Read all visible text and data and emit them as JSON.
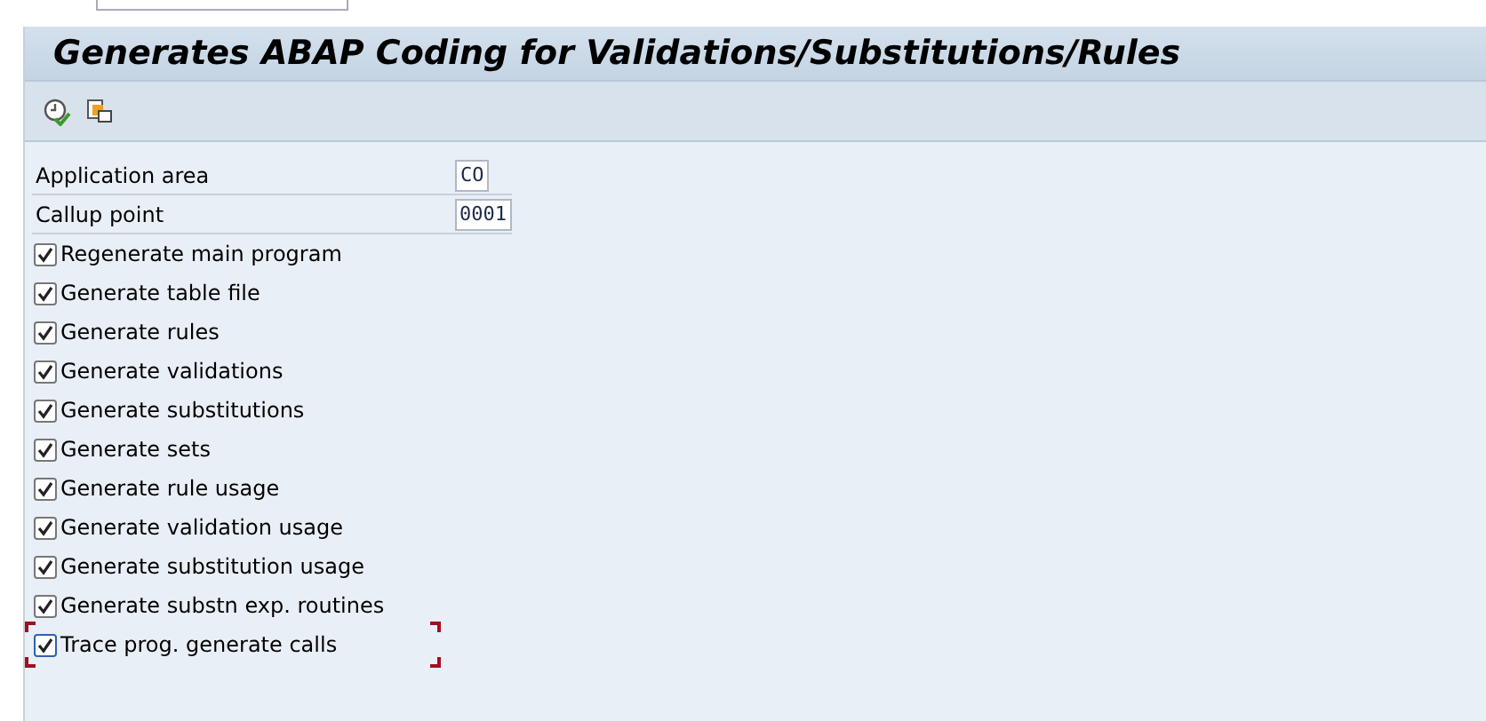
{
  "window": {
    "title": "Generates ABAP Coding for Validations/Substitutions/Rules"
  },
  "toolbar": [
    {
      "kind": "execute"
    },
    {
      "kind": "copy"
    }
  ],
  "fields": [
    {
      "label": "Application area",
      "value": "CO"
    },
    {
      "label": "Callup point",
      "value": "0001"
    }
  ],
  "options": [
    {
      "label": "Regenerate main program",
      "checked": true,
      "focused": false
    },
    {
      "label": "Generate table file",
      "checked": true,
      "focused": false
    },
    {
      "label": "Generate rules",
      "checked": true,
      "focused": false
    },
    {
      "label": "Generate validations",
      "checked": true,
      "focused": false
    },
    {
      "label": "Generate substitutions",
      "checked": true,
      "focused": false
    },
    {
      "label": "Generate sets",
      "checked": true,
      "focused": false
    },
    {
      "label": "Generate rule usage",
      "checked": true,
      "focused": false
    },
    {
      "label": "Generate validation usage",
      "checked": true,
      "focused": false
    },
    {
      "label": "Generate substitution usage",
      "checked": true,
      "focused": false
    },
    {
      "label": "Generate substn exp. routines",
      "checked": true,
      "focused": false
    },
    {
      "label": "Trace prog. generate calls",
      "checked": true,
      "focused": true
    }
  ]
}
